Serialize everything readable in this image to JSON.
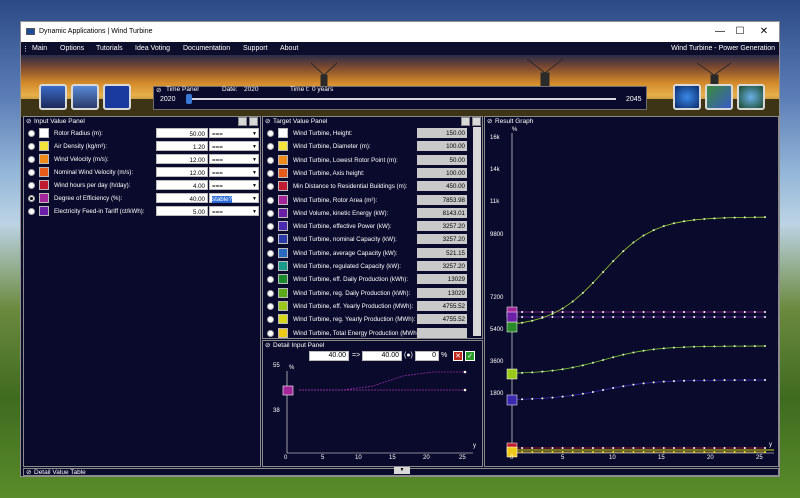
{
  "window": {
    "title": "Dynamic Applications | Wind Turbine",
    "subtitle": "Wind Turbine - Power Generation"
  },
  "menu": [
    "Main",
    "Options",
    "Tutorials",
    "Idea Voting",
    "Documentation",
    "Support",
    "About"
  ],
  "controls": {
    "minimize": "—",
    "maximize": "☐",
    "close": "✕"
  },
  "time_panel": {
    "label": "Time Panel",
    "date_label": "Date:",
    "date_value": "2020",
    "time_label": "Time t:",
    "time_value": "0 years",
    "start": "2020",
    "end": "2045",
    "progress": 0
  },
  "input_panel": {
    "title": "Input Value Panel",
    "rows": [
      {
        "label": "Rotor Radius (m):",
        "value": "50.00",
        "mode": "===",
        "color": "#ffffff",
        "selected": false
      },
      {
        "label": "Air Density (kg/m³):",
        "value": "1.20",
        "mode": "===",
        "color": "#f3e33a",
        "selected": false
      },
      {
        "label": "Wind Velocity (m/s):",
        "value": "12.00",
        "mode": "===",
        "color": "#f08a1a",
        "selected": false
      },
      {
        "label": "Nominal Wind Velocity (m/s):",
        "value": "12.00",
        "mode": "===",
        "color": "#e65a1a",
        "selected": false
      },
      {
        "label": "Wind hours per day (h/day):",
        "value": "4.00",
        "mode": "===",
        "color": "#c01b2e",
        "selected": false
      },
      {
        "label": "Degree of Efficiency (%):",
        "value": "40.00",
        "mode": "stable?",
        "color": "#a3259a",
        "selected": true
      },
      {
        "label": "Electricity Feed-in Tariff (ct/kWh):",
        "value": "5.00",
        "mode": "===",
        "color": "#6b1fa6",
        "selected": false
      }
    ]
  },
  "target_panel": {
    "title": "Target Value Panel",
    "rows": [
      {
        "label": "Wind Turbine, Height:",
        "value": "150.00",
        "color": "#ffffff"
      },
      {
        "label": "Wind Turbine, Diameter (m):",
        "value": "100.00",
        "color": "#f3e33a"
      },
      {
        "label": "Wind Turbine, Lowest Rotor Point (m):",
        "value": "50.00",
        "color": "#f08a1a"
      },
      {
        "label": "Wind Turbine, Axis height:",
        "value": "100.00",
        "color": "#e65a1a"
      },
      {
        "label": "Min Distance to Residential Buildings (m):",
        "value": "450.00",
        "color": "#c01b2e"
      },
      {
        "label": "Wind Turbine, Rotor Area (m²):",
        "value": "7853.98",
        "color": "#a3259a"
      },
      {
        "label": "Wind Volume, kinetic Energy (kW):",
        "value": "8143.01",
        "color": "#6b1fa6"
      },
      {
        "label": "Wind Turbine, effective Power (kW):",
        "value": "3257.20",
        "color": "#4a2ab0"
      },
      {
        "label": "Wind Turbine, nominal Capacity (kW):",
        "value": "3257.20",
        "color": "#2a3aa6"
      },
      {
        "label": "Wind Turbine, average Capacity (kW):",
        "value": "521.15",
        "color": "#2a6ac0"
      },
      {
        "label": "Wind Turbine, regulated Capacity (kW):",
        "value": "3257.20",
        "color": "#1a9a8a"
      },
      {
        "label": "Wind Turbine, eff. Daily Production (kWh):",
        "value": "13029",
        "color": "#1a8a2a"
      },
      {
        "label": "Wind Turbine, reg. Daily Production (kWh):",
        "value": "13029",
        "color": "#5aaa1a"
      },
      {
        "label": "Wind Turbine, eff. Yearly Production (MWh):",
        "value": "4755.52",
        "color": "#9ac81a"
      },
      {
        "label": "Wind Turbine, reg. Yearly Production (MWh):",
        "value": "4755.52",
        "color": "#d8d81a"
      },
      {
        "label": "Wind Turbine, Total Energy Production (MWh)",
        "value": "",
        "color": "#f0c81a"
      }
    ]
  },
  "detail_panel": {
    "title": "Detail Input Panel",
    "from": "40.00",
    "arrow": "=>",
    "to": "40.00",
    "star": "(●)",
    "pct": "0",
    "pct_unit": "%",
    "unit": "%",
    "yticks": [
      "55",
      "38"
    ],
    "xticks": [
      "0",
      "5",
      "10",
      "15",
      "20",
      "25"
    ],
    "xlabel": "y"
  },
  "result_panel": {
    "title": "Result Graph",
    "unit": "%",
    "xlabel": "y",
    "yticks": [
      "16k",
      "14k",
      "11k",
      "9800",
      "7200",
      "5400",
      "3600",
      "1800"
    ],
    "xticks": [
      "0",
      "5",
      "10",
      "15",
      "20",
      "25"
    ]
  },
  "detail_table": {
    "title": "Detail Value Table"
  }
}
